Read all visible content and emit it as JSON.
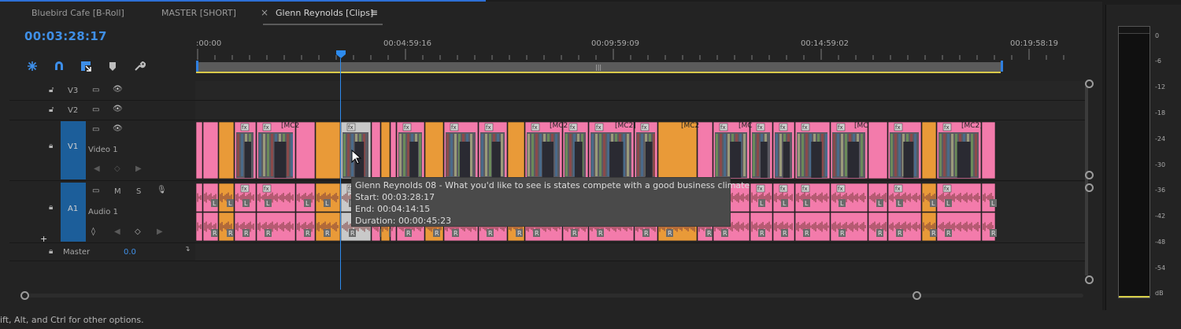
{
  "tabs": [
    {
      "label": "Bluebird Cafe [B-Roll]"
    },
    {
      "label": "MASTER [SHORT]"
    },
    {
      "label": "Glenn Reynolds [Clips]",
      "close": "×",
      "menu": "≡"
    }
  ],
  "timecode": "00:03:28:17",
  "ruler": {
    "labels": [
      ":00:00",
      "00:04:59:16",
      "00:09:59:09",
      "00:14:59:02",
      "00:19:58:19"
    ]
  },
  "tools": [
    "snap-icon",
    "magnet-icon",
    "linked-selection-icon",
    "marker-icon",
    "wrench-icon"
  ],
  "tracks": {
    "v3": {
      "label": "V3"
    },
    "v2": {
      "label": "V2"
    },
    "v1": {
      "target": "V1",
      "name": "Video 1"
    },
    "a1": {
      "target": "A1",
      "name": "Audio 1",
      "mute": "M",
      "solo": "S"
    },
    "master": {
      "name": "Master",
      "value": "0.0"
    }
  },
  "clips": {
    "fx": "fx",
    "mc": [
      "[MC2",
      "[MC2]",
      "[MC2",
      "[MC",
      "[MC2]"
    ],
    "left_ch": "L",
    "right_ch": "R"
  },
  "tooltip": {
    "title": "Glenn Reynolds 08 - What you'd like to see is states compete with a good business climate",
    "start": "Start: 00:03:28:17",
    "end": "End: 00:04:14:15",
    "duration": "Duration: 00:00:45:23"
  },
  "meter": {
    "labels": [
      "0",
      "-6",
      "-12",
      "-18",
      "-24",
      "-30",
      "-36",
      "-42",
      "-48",
      "-54",
      "dB"
    ]
  },
  "status": "ift, Alt, and Ctrl for other options.",
  "colors": {
    "accent": "#2d8bee",
    "video_clip": "#f37bab",
    "audio_clip": "#e99a38",
    "timecode": "#3f8fe6"
  }
}
